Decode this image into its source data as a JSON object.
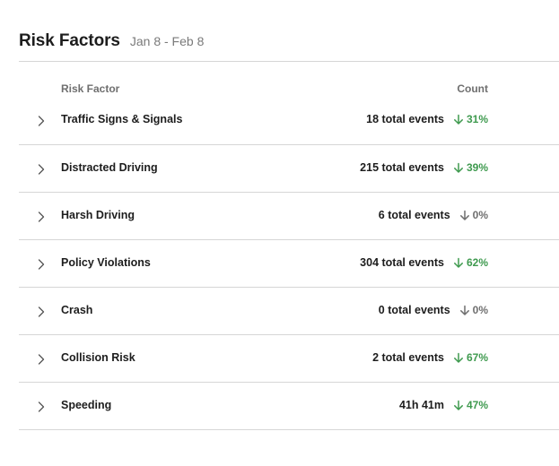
{
  "header": {
    "title": "Risk Factors",
    "date_range": "Jan 8 - Feb 8"
  },
  "table": {
    "columns": {
      "factor": "Risk Factor",
      "count": "Count"
    },
    "rows": [
      {
        "label": "Traffic Signs & Signals",
        "count": "18 total events",
        "change": "31%",
        "trend": "good"
      },
      {
        "label": "Distracted Driving",
        "count": "215 total events",
        "change": "39%",
        "trend": "good"
      },
      {
        "label": "Harsh Driving",
        "count": "6 total events",
        "change": "0%",
        "trend": "neutral"
      },
      {
        "label": "Policy Violations",
        "count": "304 total events",
        "change": "62%",
        "trend": "good"
      },
      {
        "label": "Crash",
        "count": "0 total events",
        "change": "0%",
        "trend": "neutral"
      },
      {
        "label": "Collision Risk",
        "count": "2 total events",
        "change": "67%",
        "trend": "good"
      },
      {
        "label": "Speeding",
        "count": "41h 41m",
        "change": "47%",
        "trend": "good"
      }
    ]
  },
  "icons": {
    "expand": "chevron-right-icon",
    "trend": "arrow-down-icon"
  },
  "colors": {
    "good": "#3f9a4f",
    "neutral": "#6f6f6f",
    "divider": "#d6d6d6"
  }
}
